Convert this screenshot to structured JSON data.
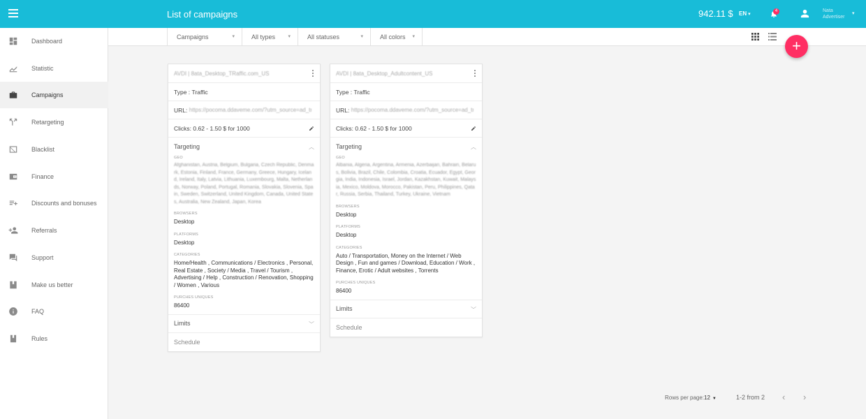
{
  "header": {
    "title": "List of campaigns",
    "balance": "942.11 $",
    "lang": "EN",
    "notifications_count": "4",
    "user_name_line1": "Nata",
    "user_name_line2": "Advertiser"
  },
  "sidebar": {
    "items": [
      {
        "label": "Dashboard",
        "icon": "dashboard-icon"
      },
      {
        "label": "Statistic",
        "icon": "statistic-icon"
      },
      {
        "label": "Campaigns",
        "icon": "briefcase-icon",
        "active": true
      },
      {
        "label": "Retargeting",
        "icon": "retargeting-icon"
      },
      {
        "label": "Blacklist",
        "icon": "blacklist-icon"
      },
      {
        "label": "Finance",
        "icon": "wallet-icon"
      },
      {
        "label": "Discounts and bonuses",
        "icon": "playlist-add-icon"
      },
      {
        "label": "Referrals",
        "icon": "person-add-icon"
      },
      {
        "label": "Support",
        "icon": "chat-icon"
      },
      {
        "label": "Make us better",
        "icon": "bookmark-icon"
      },
      {
        "label": "FAQ",
        "icon": "info-icon"
      },
      {
        "label": "Rules",
        "icon": "book-icon"
      }
    ]
  },
  "filters": {
    "campaigns": "Campaigns",
    "types": "All types",
    "statuses": "All statuses",
    "colors": "All colors"
  },
  "cards": [
    {
      "title": "AVDI | 8ata_Desktop_TRaffic.com_US",
      "type_label": "Type :",
      "type_value": "Traffic",
      "url_label": "URL:",
      "url_value": "https://pocoma.ddaveme.com/?utm_source=ad_traffic_mmm",
      "clicks_label": "Clicks:",
      "clicks_value": "0.62 - 1.50 $ for 1000",
      "targeting_label": "Targeting",
      "geo_label": "GEO",
      "geo_value": "Afghanistan, Austria, Belgium, Bulgaria, Czech Republic, Denmark, Estonia, Finland, France, Germany, Greece, Hungary, Iceland, Ireland, Italy, Latvia, Lithuania, Luxembourg, Malta, Netherlands, Norway, Poland, Portugal, Romania, Slovakia, Slovenia, Spain, Sweden, Switzerland, United Kingdom, Canada, United States, Australia, New Zealand, Japan, Korea",
      "browsers_label": "BROWSERS",
      "browsers_value": "Desktop",
      "platforms_label": "PLATFORMS",
      "platforms_value": "Desktop",
      "categories_label": "CATEGORIES",
      "categories_value": "Home/Health , Communications / Electronics , Personal, Real Estate , Society / Media , Travel / Tourism , Advertising / Help , Construction / Renovation, Shopping / Women , Various",
      "uniques_label": "PURCHES UNIQUES",
      "uniques_value": "86400",
      "limits_label": "Limits",
      "schedule_label": "Schedule"
    },
    {
      "title": "AVDI | 8ata_Desktop_Adultcontent_US",
      "type_label": "Type :",
      "type_value": "Traffic",
      "url_label": "URL:",
      "url_value": "https://pocoma.ddaveme.com/?utm_source=ad_traffic_nnn",
      "clicks_label": "Clicks:",
      "clicks_value": "0.62 - 1.50 $ for 1000",
      "targeting_label": "Targeting",
      "geo_label": "GEO",
      "geo_value": "Albania, Algeria, Argentina, Armenia, Azerbaijan, Bahrain, Belarus, Bolivia, Brazil, Chile, Colombia, Croatia, Ecuador, Egypt, Georgia, India, Indonesia, Israel, Jordan, Kazakhstan, Kuwait, Malaysia, Mexico, Moldova, Morocco, Pakistan, Peru, Philippines, Qatar, Russia, Serbia, Thailand, Turkey, Ukraine, Vietnam",
      "browsers_label": "BROWSERS",
      "browsers_value": "Desktop",
      "platforms_label": "PLATFORMS",
      "platforms_value": "Desktop",
      "categories_label": "CATEGORIES",
      "categories_value": "Auto / Transportation, Money on the Internet / Web Design , Fun and games / Download, Education / Work , Finance, Erotic / Adult websites , Torrents",
      "uniques_label": "PURCHES UNIQUES",
      "uniques_value": "86400",
      "limits_label": "Limits",
      "schedule_label": "Schedule"
    }
  ],
  "pagination": {
    "rows_per_page_label": "Rows per page:",
    "rows_per_page": "12",
    "range": "1-2 from 2"
  },
  "colors": {
    "accent": "#18bcd8",
    "fab": "#ff2e63"
  }
}
